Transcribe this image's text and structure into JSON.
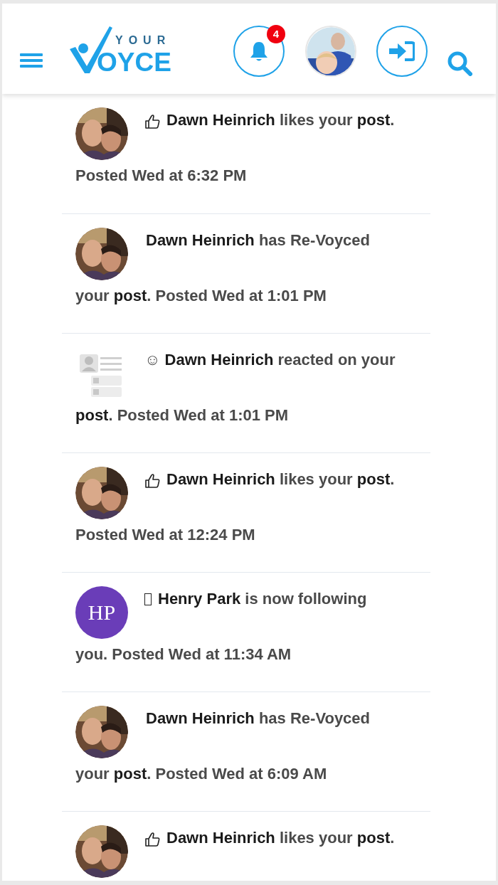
{
  "header": {
    "logo": {
      "top": "YOUR",
      "main": "OYCE"
    },
    "notifications": {
      "badge": "4"
    }
  },
  "notifications": [
    {
      "kind": "like",
      "headline": "**Dawn Heinrich** likes your **post**.",
      "subline": "Posted Wed at 6:32 PM"
    },
    {
      "kind": "revoyce",
      "headline": "**Dawn Heinrich** has Re-Voyced",
      "subline": "your **post**. Posted Wed at 1:01 PM"
    },
    {
      "avatar": {
        "kind": "placeholder"
      },
      "kind": "reaction",
      "headline": "☺ **Dawn Heinrich** reacted on your",
      "subline": "**post**. Posted Wed at 1:01 PM"
    },
    {
      "kind": "like",
      "headline": "**Dawn Heinrich** likes your **post**.",
      "subline": "Posted Wed at 12:24 PM"
    },
    {
      "avatar": {
        "kind": "initials",
        "initials": "HP",
        "color": "#6a3db8"
      },
      "kind": "follow",
      "headline": "**Henry Park** is now following",
      "subline": "you. Posted Wed at 11:34 AM"
    },
    {
      "kind": "revoyce",
      "headline": "**Dawn Heinrich** has Re-Voyced",
      "subline": "your **post**. Posted Wed at 6:09 AM"
    },
    {
      "kind": "like",
      "headline": "**Dawn Heinrich** likes your **post**."
    }
  ]
}
